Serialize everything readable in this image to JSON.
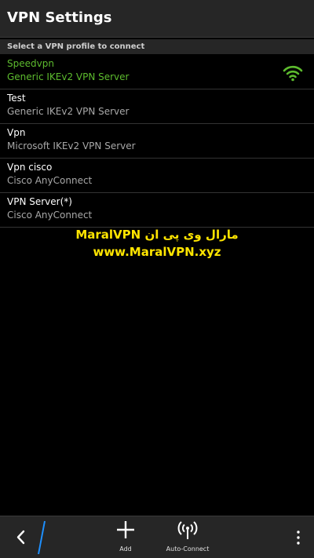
{
  "header": {
    "title": "VPN Settings"
  },
  "section": {
    "label": "Select a VPN profile to connect"
  },
  "profiles": [
    {
      "name": "Speedvpn",
      "type": "Generic IKEv2 VPN Server"
    },
    {
      "name": "Test",
      "type": "Generic IKEv2 VPN Server"
    },
    {
      "name": "Vpn",
      "type": "Microsoft IKEv2 VPN Server"
    },
    {
      "name": "Vpn cisco",
      "type": "Cisco AnyConnect"
    },
    {
      "name": "VPN Server(*)",
      "type": "Cisco AnyConnect"
    }
  ],
  "watermark": {
    "line1": "MaralVPN مارال وی پی ان",
    "line2": "www.MaralVPN.xyz"
  },
  "actionbar": {
    "add_label": "Add",
    "auto_connect_label": "Auto-Connect"
  },
  "colors": {
    "active": "#5dbb2e",
    "watermark": "#ffe500",
    "accent": "#1e90ff"
  },
  "icons": {
    "connected": "wifi-signal-icon",
    "back": "chevron-left-icon",
    "add": "plus-icon",
    "auto_connect": "antenna-icon",
    "overflow": "more-vertical-icon"
  }
}
